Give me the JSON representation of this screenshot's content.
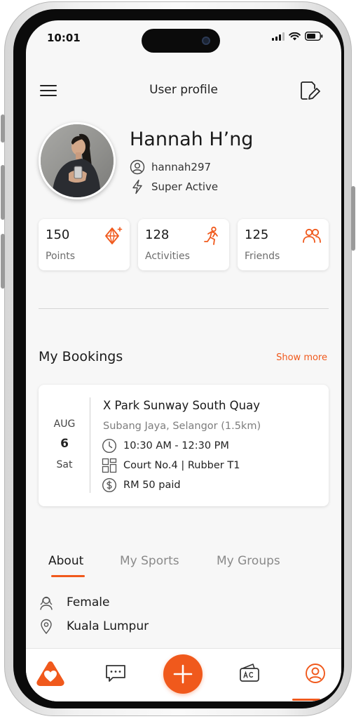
{
  "status_bar": {
    "time": "10:01"
  },
  "header": {
    "title": "User profile"
  },
  "profile": {
    "name": "Hannah H’ng",
    "username": "hannah297",
    "activity_level": "Super Active"
  },
  "stats": [
    {
      "value": "150",
      "label": "Points",
      "icon": "diamond-sparkle-icon"
    },
    {
      "value": "128",
      "label": "Activities",
      "icon": "running-person-icon"
    },
    {
      "value": "125",
      "label": "Friends",
      "icon": "users-icon"
    }
  ],
  "bookings": {
    "title": "My Bookings",
    "show_more": "Show more",
    "items": [
      {
        "month": "AUG",
        "day": "6",
        "weekday": "Sat",
        "venue": "X Park Sunway South Quay",
        "location": "Subang Jaya, Selangor (1.5km)",
        "time": "10:30 AM - 12:30 PM",
        "court": "Court No.4 | Rubber T1",
        "payment": "RM 50 paid"
      }
    ]
  },
  "tabs": [
    {
      "label": "About",
      "active": true
    },
    {
      "label": "My Sports",
      "active": false
    },
    {
      "label": "My Groups",
      "active": false
    }
  ],
  "about": {
    "gender": "Female",
    "city": "Kuala Lumpur"
  },
  "bottom_nav": {
    "items": [
      "home-heart-icon",
      "chat-icon",
      "add-icon",
      "wallet-icon",
      "profile-icon"
    ],
    "active": "profile-icon"
  },
  "colors": {
    "accent": "#f0591c",
    "background": "#f7f7f7",
    "card": "#ffffff"
  }
}
